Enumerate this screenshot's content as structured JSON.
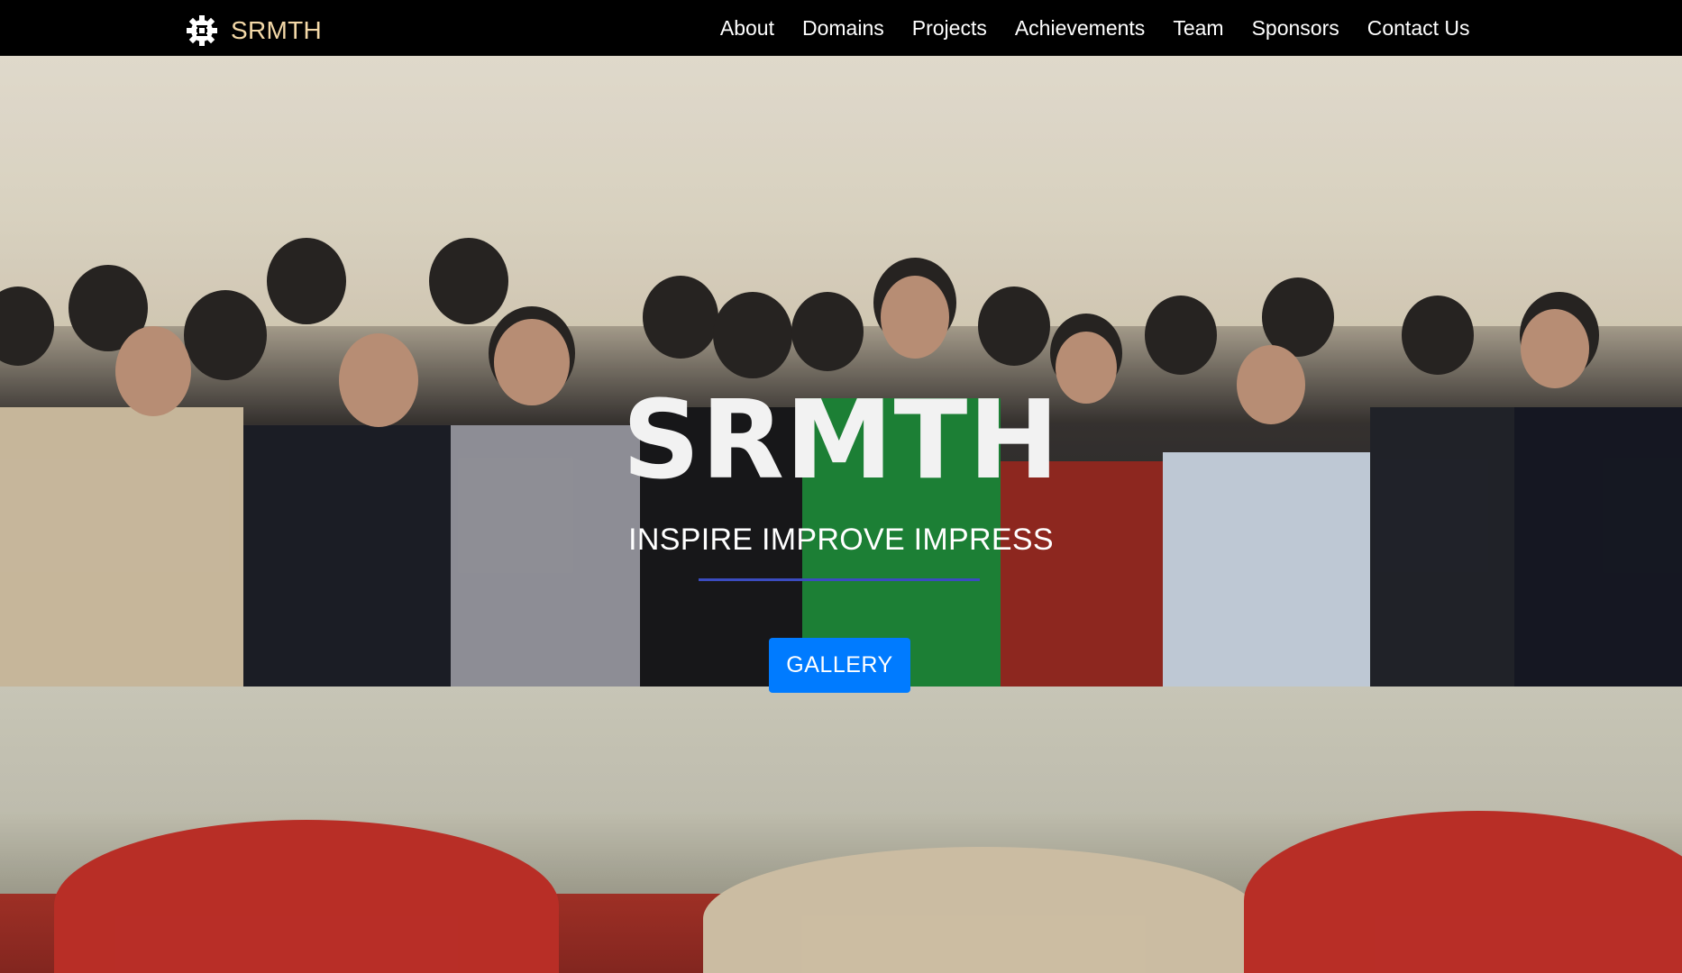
{
  "brand": {
    "icon": "gear-circuit-icon",
    "name": "SRMTH",
    "name_color": "#f4d9a8"
  },
  "nav": {
    "items": [
      {
        "label": "About"
      },
      {
        "label": "Domains"
      },
      {
        "label": "Projects"
      },
      {
        "label": "Achievements"
      },
      {
        "label": "Team"
      },
      {
        "label": "Sponsors"
      },
      {
        "label": "Contact Us"
      }
    ]
  },
  "hero": {
    "background": "group-photo",
    "title": "SRMTH",
    "subtitle": "INSPIRE IMPROVE IMPRESS",
    "divider_color": "#3b4cc0",
    "button_label": "GALLERY",
    "button_color": "#007bff"
  }
}
